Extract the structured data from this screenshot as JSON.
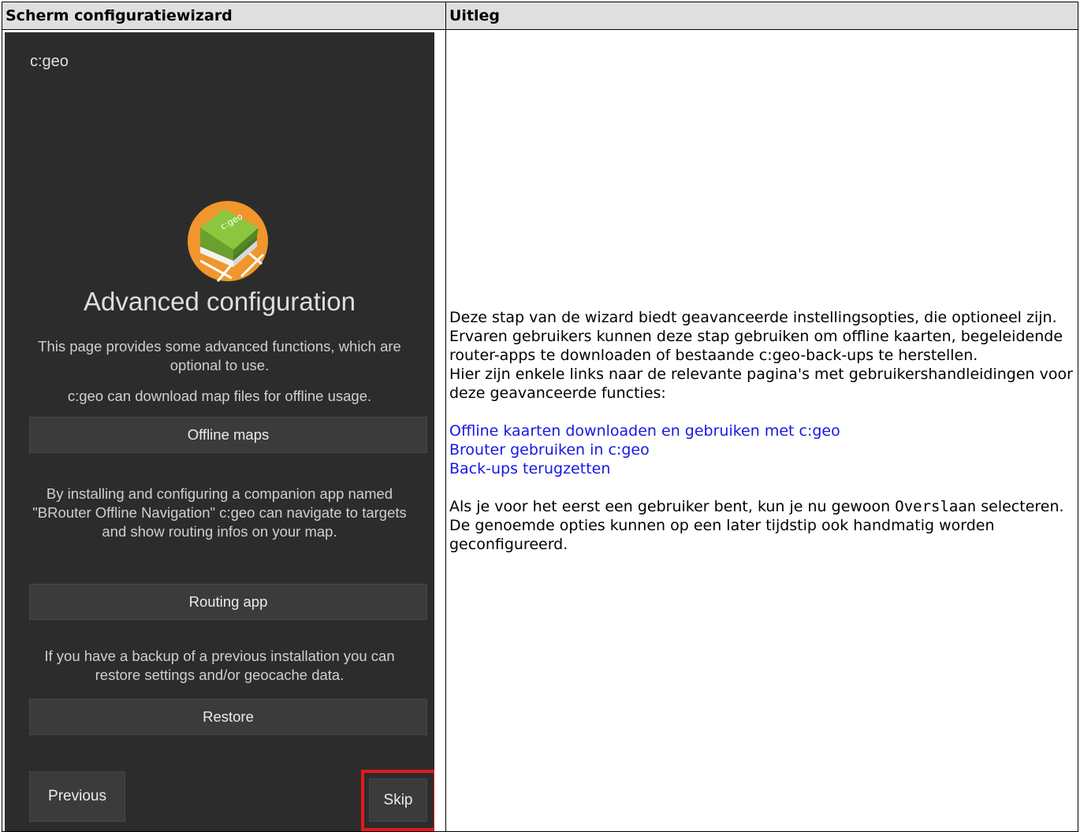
{
  "table": {
    "col1_header": "Scherm configuratiewizard",
    "col2_header": "Uitleg"
  },
  "phone": {
    "app_name": "c:geo",
    "logo_text": "c:geo",
    "title": "Advanced configuration",
    "intro": "This page provides some advanced functions, which are optional to use.",
    "maps_text": "c:geo can download map files for offline usage.",
    "offline_maps_button": "Offline maps",
    "routing_text": "By installing and configuring a companion app named \"BRouter Offline Navigation\" c:geo can navigate to targets and show routing infos on your map.",
    "routing_button": "Routing app",
    "restore_text": "If you have a backup of a previous installation you can restore settings and/or geocache data.",
    "restore_button": "Restore",
    "previous_button": "Previous",
    "skip_button": "Skip",
    "highlight_color": "#e01a1a"
  },
  "explanation": {
    "paragraph1": "Deze stap van de wizard biedt geavanceerde instellingsopties, die optioneel zijn. Ervaren gebruikers kunnen deze stap gebruiken om offline kaarten, begeleidende router-apps te downloaden of bestaande c:geo-back-ups te herstellen.",
    "paragraph2": "Hier zijn enkele links naar de relevante pagina's met gebruikershandleidingen voor deze geavanceerde functies:",
    "links": [
      "Offline kaarten downloaden en gebruiken met c:geo",
      "Brouter gebruiken in c:geo",
      "Back-ups terugzetten"
    ],
    "note_before": "Als je voor het eerst een gebruiker bent, kun je nu gewoon ",
    "note_code": "Overslaan",
    "note_after": " selecteren. De genoemde opties kunnen op een later tijdstip ook handmatig worden geconfigureerd.",
    "link_color": "#1717e6"
  }
}
